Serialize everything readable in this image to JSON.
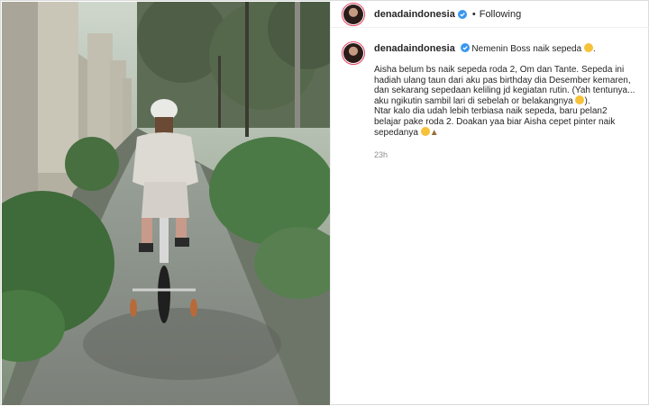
{
  "post": {
    "username": "denadaindonesia",
    "follow_status": "Following",
    "time": "23h",
    "caption_head": "Nemenin Boss naik sepeda",
    "caption_lines": [
      "Aisha belum bs naik sepeda roda 2, Om dan Tante. Sepeda ini",
      "hadiah ulang taun dari aku pas birthday dia Desember kemaren,",
      "dan sekarang sepedaan keliling jd kegiatan rutin. (Yah tentunya...",
      "aku ngikutin sambil lari di sebelah or belakangnya",
      "Ntar kalo dia udah lebih terbiasa naik sepeda, baru pelan2",
      "belajar pake roda 2. Doakan yaa biar Aisha cepet pinter naik",
      "sepedanya"
    ]
  },
  "icons": {
    "verified": "verified-badge-icon",
    "emoji_grin": "grinning-face-emoji",
    "emoji_lol": "laughing-face-emoji",
    "emoji_blush": "smiling-face-emoji",
    "emoji_pray": "folded-hands-emoji"
  },
  "colors": {
    "verified": "#3897f0",
    "story_ring": "#e4405f",
    "muted_text": "#8e8e8e"
  }
}
